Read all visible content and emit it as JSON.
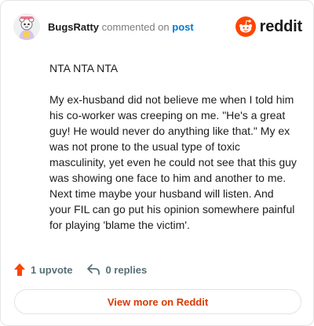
{
  "header": {
    "username": "BugsRatty",
    "action_text": "commented on",
    "target_link": "post",
    "brand": "reddit"
  },
  "comment": {
    "paragraphs": [
      "NTA NTA NTA",
      "My ex-husband did not believe me when I told him his co-worker was creeping on me. \"He's a great guy! He would never do anything like that.\" My ex was not prone to the usual type of toxic masculinity, yet even he could not see that this guy was showing one face to him and another to me. Next time maybe your husband will listen. And your FIL can go put his opinion somewhere painful for playing 'blame the victim'."
    ]
  },
  "actions": {
    "upvotes": "1 upvote",
    "replies": "0 replies"
  },
  "cta": {
    "label": "View more on Reddit"
  },
  "colors": {
    "accent": "#ff4500",
    "link": "#0079d3",
    "cta_text": "#d93900"
  }
}
